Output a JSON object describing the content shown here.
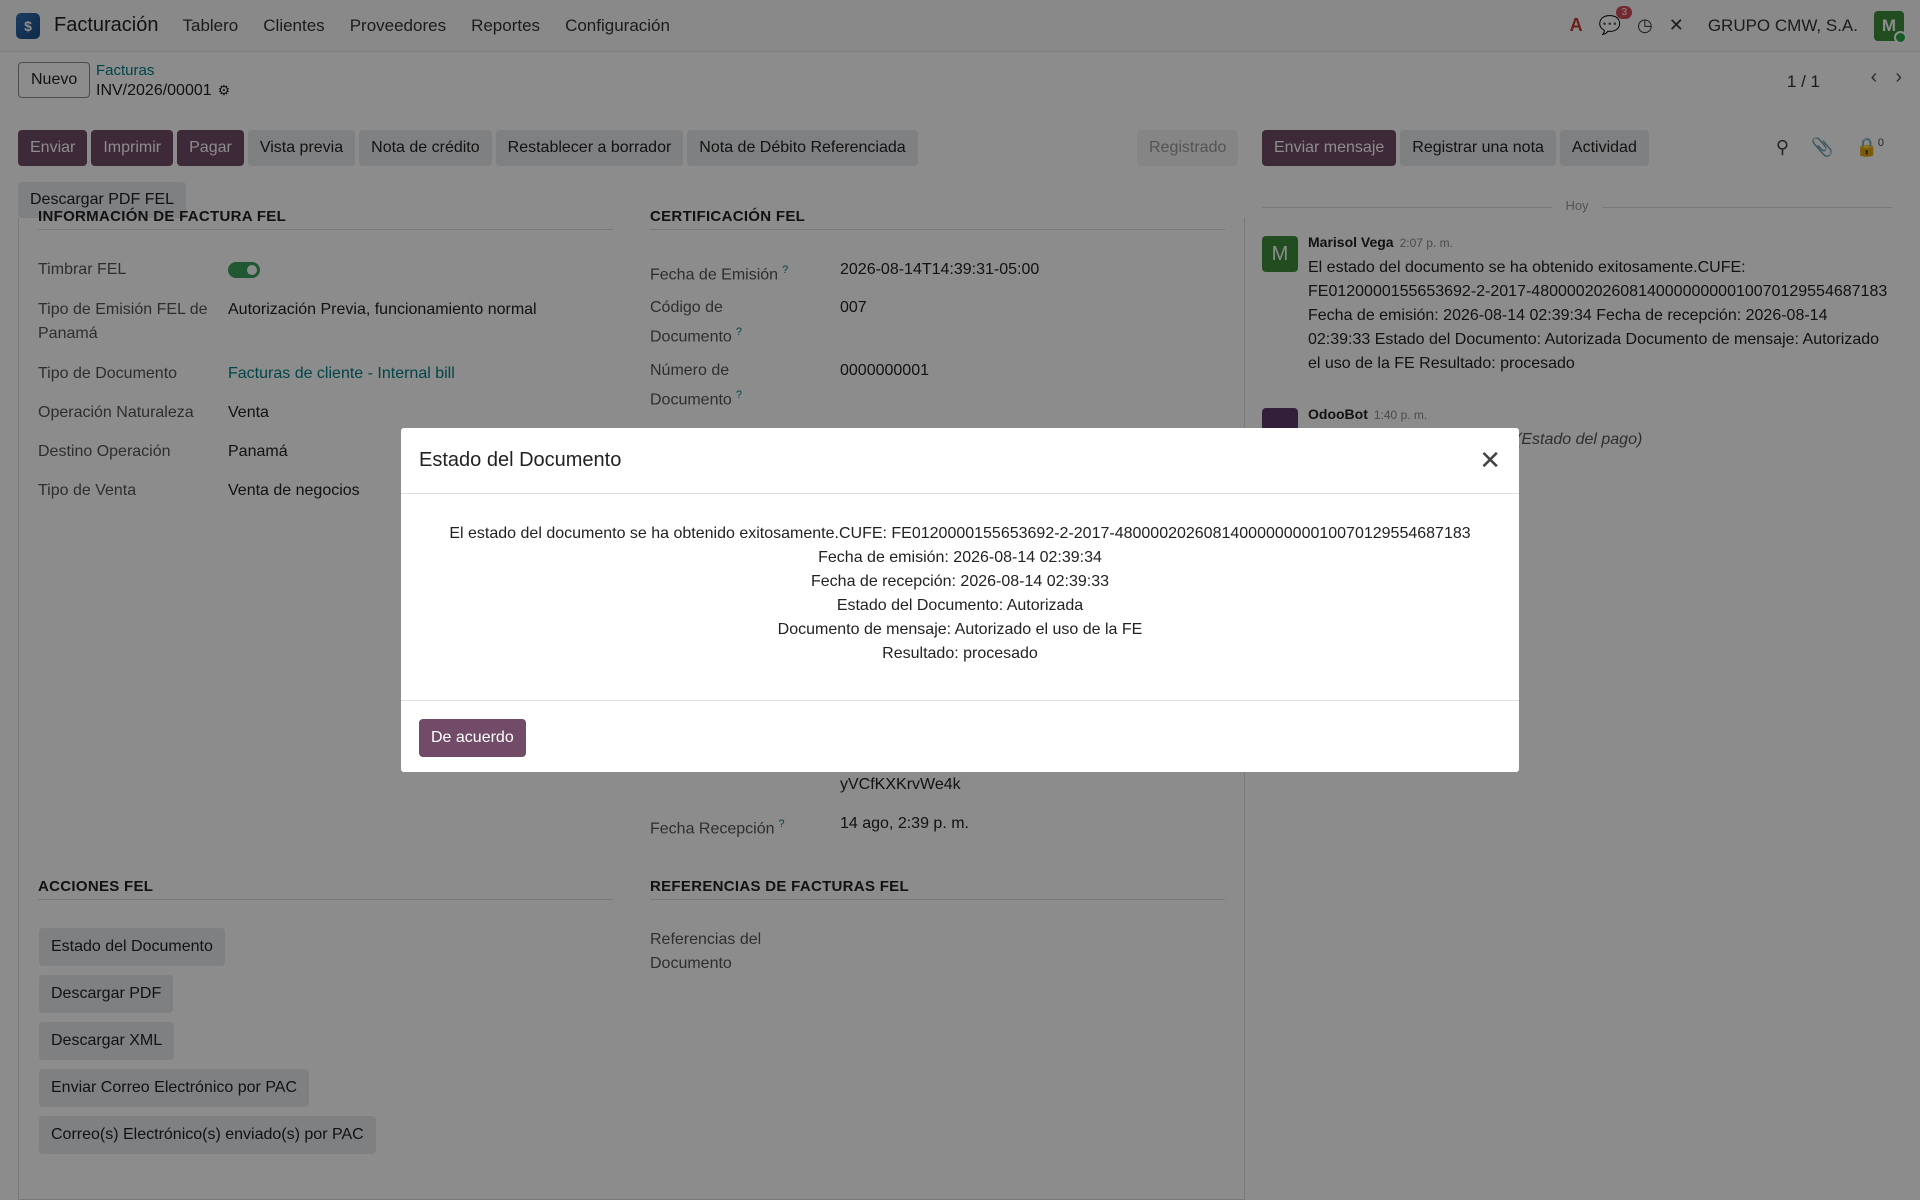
{
  "navbar": {
    "app_icon": "$",
    "app_name": "Facturación",
    "menus": [
      "Tablero",
      "Clientes",
      "Proveedores",
      "Reportes",
      "Configuración"
    ],
    "messages_badge": "3",
    "company": "GRUPO CMW, S.A.",
    "user_initial": "M"
  },
  "control": {
    "new_label": "Nuevo",
    "breadcrumb_parent": "Facturas",
    "breadcrumb_current": "INV/2026/00001",
    "pager": "1 / 1"
  },
  "statusbar": {
    "buttons": [
      "Enviar",
      "Imprimir",
      "Pagar",
      "Vista previa",
      "Nota de crédito",
      "Restablecer a borrador",
      "Nota de Débito Referenciada",
      "Descargar PDF FEL"
    ],
    "state": "Registrado"
  },
  "chatter_actions": {
    "send_message": "Enviar mensaje",
    "log_note": "Registrar una nota",
    "activity": "Actividad",
    "followers_count": "0"
  },
  "form": {
    "info_title": "INFORMACIÓN DE FACTURA FEL",
    "cert_title": "CERTIFICACIÓN FEL",
    "info_fields": [
      {
        "label": "Timbrar FEL",
        "value": ""
      },
      {
        "label": "Tipo de Emisión FEL de Panamá",
        "value": "Autorización Previa, funcionamiento normal"
      },
      {
        "label": "Tipo de Documento",
        "value": "Facturas de cliente - Internal bill"
      },
      {
        "label": "Operación Naturaleza",
        "value": "Venta"
      },
      {
        "label": "Destino Operación",
        "value": "Panamá"
      },
      {
        "label": "Tipo de Venta",
        "value": "Venta de negocios"
      }
    ],
    "cert_fields": [
      {
        "label": "Fecha de Emisión",
        "value": "2026-08-14T14:39:31-05:00"
      },
      {
        "label": "Código de Documento",
        "value": "007"
      },
      {
        "label": "Número de Documento",
        "value": "0000000001"
      }
    ],
    "partial_value": "yVCfKXKrvWe4k",
    "reception_label": "Fecha Recepción",
    "reception_value": "14 ago, 2:39 p. m.",
    "actions_title": "ACCIONES FEL",
    "actions": [
      "Estado del Documento",
      "Descargar PDF",
      "Descargar XML",
      "Enviar Correo Electrónico por PAC",
      "Correo(s) Electrónico(s) enviado(s) por PAC"
    ],
    "refs_title": "REFERENCIAS DE FACTURAS FEL",
    "refs_label": "Referencias del Documento"
  },
  "chatter": {
    "day": "Hoy",
    "messages": [
      {
        "author": "Marisol Vega",
        "time": "2:07 p. m.",
        "initial": "M",
        "body": "El estado del documento se ha obtenido exitosamente.CUFE: FE0120000155653692-2-2017-4800002026081400000000010070129554687183 Fecha de emisión: 2026-08-14 02:39:34 Fecha de recepción: 2026-08-14 02:39:33 Estado del Documento: Autorizada Documento de mensaje: Autorizado el uso de la FE Resultado: procesado"
      },
      {
        "author": "OdooBot",
        "time": "1:40 p. m.",
        "body": "(Estado del pago)"
      }
    ]
  },
  "modal": {
    "title": "Estado del Documento",
    "lines": [
      "El estado del documento se ha obtenido exitosamente.CUFE: FE0120000155653692-2-2017-4800002026081400000000010070129554687183",
      "Fecha de emisión: 2026-08-14 02:39:34",
      "Fecha de recepción: 2026-08-14 02:39:33",
      "Estado del Documento: Autorizada",
      "Documento de mensaje: Autorizado el uso de la FE",
      "Resultado: procesado"
    ],
    "ok_label": "De acuerdo"
  }
}
